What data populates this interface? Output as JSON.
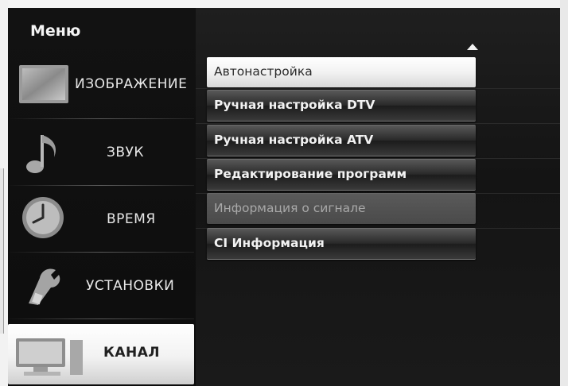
{
  "menu": {
    "title": "Меню"
  },
  "sidebar": {
    "items": [
      {
        "label": "ИЗОБРАЖЕНИЕ",
        "icon": "monitor-icon"
      },
      {
        "label": "ЗВУК",
        "icon": "music-note-icon"
      },
      {
        "label": "ВРЕМЯ",
        "icon": "clock-icon"
      },
      {
        "label": "УСТАНОВКИ",
        "icon": "wrench-icon"
      },
      {
        "label": "КАНАЛ",
        "icon": "computer-icon",
        "selected": true
      }
    ]
  },
  "options": [
    {
      "label": "Автонастройка",
      "state": "highlighted"
    },
    {
      "label": "Ручная настройка DTV",
      "state": "normal"
    },
    {
      "label": "Ручная настройка ATV",
      "state": "normal"
    },
    {
      "label": "Редактирование программ",
      "state": "normal"
    },
    {
      "label": "Информация о сигнале",
      "state": "disabled"
    },
    {
      "label": "CI Информация",
      "state": "normal"
    }
  ],
  "colors": {
    "highlight": "#f2f2f2",
    "background": "#141414",
    "disabled_text": "#a8a8a8"
  }
}
